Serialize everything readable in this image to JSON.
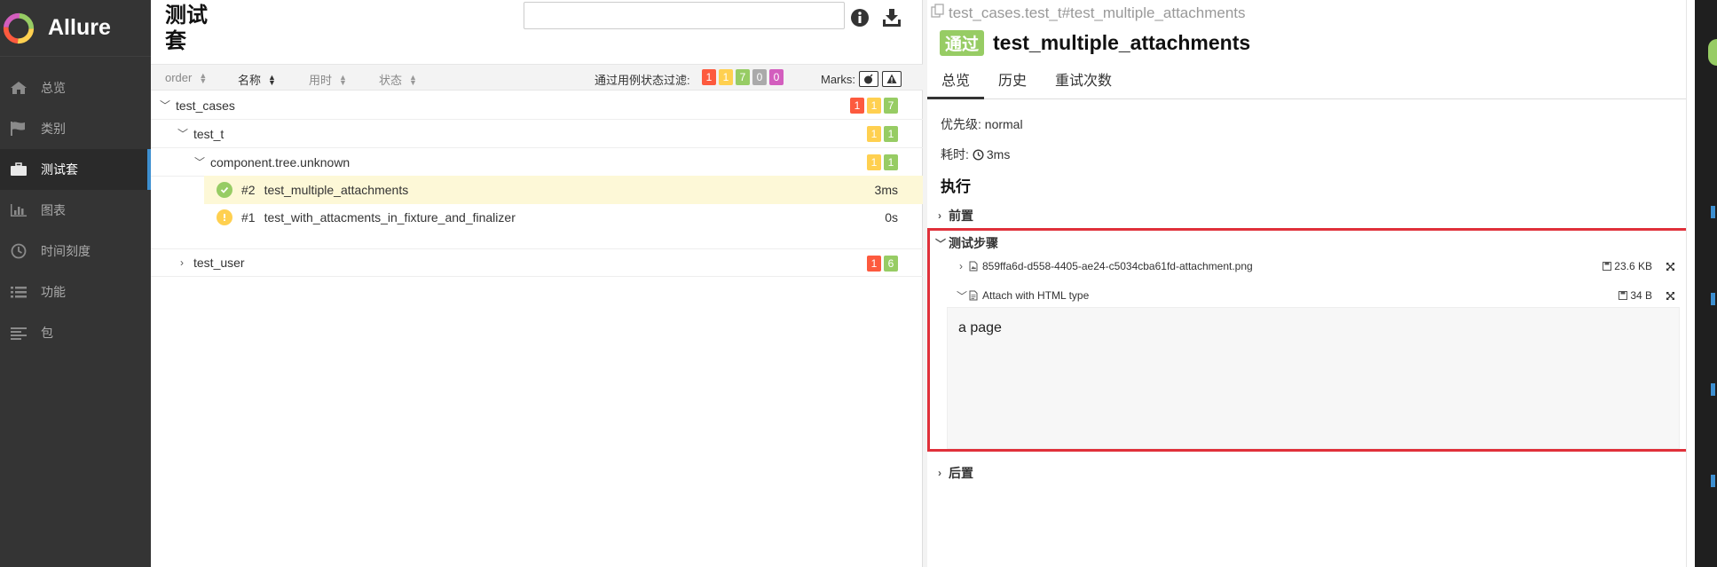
{
  "sidebar": {
    "brand": "Allure",
    "items": [
      {
        "label": "总览",
        "icon": "home-icon",
        "active": false
      },
      {
        "label": "类别",
        "icon": "flag-icon",
        "active": false
      },
      {
        "label": "测试套",
        "icon": "briefcase-icon",
        "active": true
      },
      {
        "label": "图表",
        "icon": "bar-chart-icon",
        "active": false
      },
      {
        "label": "时间刻度",
        "icon": "clock-icon",
        "active": false
      },
      {
        "label": "功能",
        "icon": "list-icon",
        "active": false
      },
      {
        "label": "包",
        "icon": "align-left-icon",
        "active": false
      }
    ]
  },
  "suites": {
    "title": "测试套",
    "search_placeholder": "",
    "sort": {
      "order": "order",
      "name": "名称",
      "duration": "用时",
      "status": "状态"
    },
    "filter_label": "通过用例状态过滤:",
    "filter_counts": [
      "1",
      "1",
      "7",
      "0",
      "0"
    ],
    "marks_label": "Marks:",
    "tree": {
      "test_cases": {
        "label": "test_cases",
        "counts": [
          "1",
          "1",
          "7"
        ]
      },
      "test_t": {
        "label": "test_t",
        "counts": [
          "1",
          "1"
        ]
      },
      "component": {
        "label": "component.tree.unknown",
        "counts": [
          "1",
          "1"
        ]
      },
      "tc1": {
        "order": "#2",
        "name": "test_multiple_attachments",
        "duration": "3ms",
        "status": "passed"
      },
      "tc2": {
        "order": "#1",
        "name": "test_with_attacments_in_fixture_and_finalizer",
        "duration": "0s",
        "status": "broken"
      },
      "test_user": {
        "label": "test_user",
        "counts": [
          "1",
          "6"
        ]
      }
    }
  },
  "detail": {
    "path": "test_cases.test_t#test_multiple_attachments",
    "status_label": "通过",
    "test_name": "test_multiple_attachments",
    "tabs": [
      "总览",
      "历史",
      "重试次数"
    ],
    "severity_label": "优先级:",
    "severity_value": "normal",
    "duration_label": "耗时:",
    "duration_value": "3ms",
    "execution_title": "执行",
    "setup_label": "前置",
    "steps_label": "测试步骤",
    "teardown_label": "后置",
    "attachments": [
      {
        "name": "859ffa6d-d558-4405-ae24-c5034cba61fd-attachment.png",
        "size": "23.6 KB"
      },
      {
        "name": "Attach with HTML type",
        "size": "34 B"
      }
    ],
    "preview_text": "a page"
  },
  "colors": {
    "passed": "#97cc64",
    "failed": "#fd5a3e",
    "broken": "#ffd050",
    "skipped": "#aaaaaa",
    "unknown": "#d35ebe",
    "sidebar_bg": "#343434",
    "highlight_border": "#e0303a"
  }
}
